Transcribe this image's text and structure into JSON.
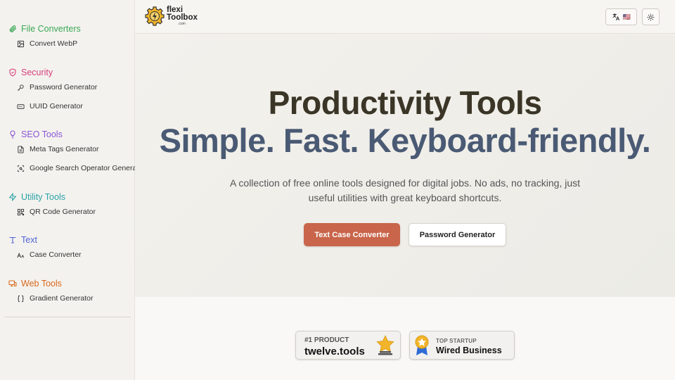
{
  "sidebar": {
    "categories": [
      {
        "label": "File Converters",
        "color": "#3aa856",
        "icon": "paperclip-icon",
        "items": [
          {
            "label": "Convert WebP",
            "icon": "image-icon"
          }
        ]
      },
      {
        "label": "Security",
        "color": "#d6407e",
        "icon": "shield-icon",
        "items": [
          {
            "label": "Password Generator",
            "icon": "key-icon"
          },
          {
            "label": "UUID Generator",
            "icon": "id-card-icon"
          }
        ]
      },
      {
        "label": "SEO Tools",
        "color": "#8a55d6",
        "icon": "lightbulb-icon",
        "items": [
          {
            "label": "Meta Tags Generator",
            "icon": "document-icon"
          },
          {
            "label": "Google Search Operator Generator",
            "icon": "scan-search-icon"
          }
        ]
      },
      {
        "label": "Utility Tools",
        "color": "#2aa3a8",
        "icon": "lightning-icon",
        "items": [
          {
            "label": "QR Code Generator",
            "icon": "qr-code-icon"
          }
        ]
      },
      {
        "label": "Text",
        "color": "#4f63d8",
        "icon": "text-type-icon",
        "items": [
          {
            "label": "Case Converter",
            "icon": "case-sensitive-icon"
          }
        ]
      },
      {
        "label": "Web Tools",
        "color": "#d86a1e",
        "icon": "monitor-icon",
        "items": [
          {
            "label": "Gradient Generator",
            "icon": "braces-icon"
          }
        ]
      }
    ]
  },
  "header": {
    "logo": {
      "line1": "flexi",
      "line2": "Toolbox",
      "line3": ".com"
    },
    "language_flag": "🇺🇸"
  },
  "hero": {
    "title": "Productivity Tools",
    "subtitle": "Simple. Fast. Keyboard-friendly.",
    "description": "A collection of free online tools designed for digital jobs. No ads, no tracking, just useful utilities with great keyboard shortcuts.",
    "primary_button": "Text Case Converter",
    "secondary_button": "Password Generator"
  },
  "badges": [
    {
      "small": "#1 PRODUCT",
      "big": "twelve.tools"
    },
    {
      "small": "TOP STARTUP",
      "big": "Wired Business"
    }
  ],
  "colors": {
    "accent": "#c8654a",
    "title": "#3a3526",
    "subtitle": "#4a5a74"
  }
}
